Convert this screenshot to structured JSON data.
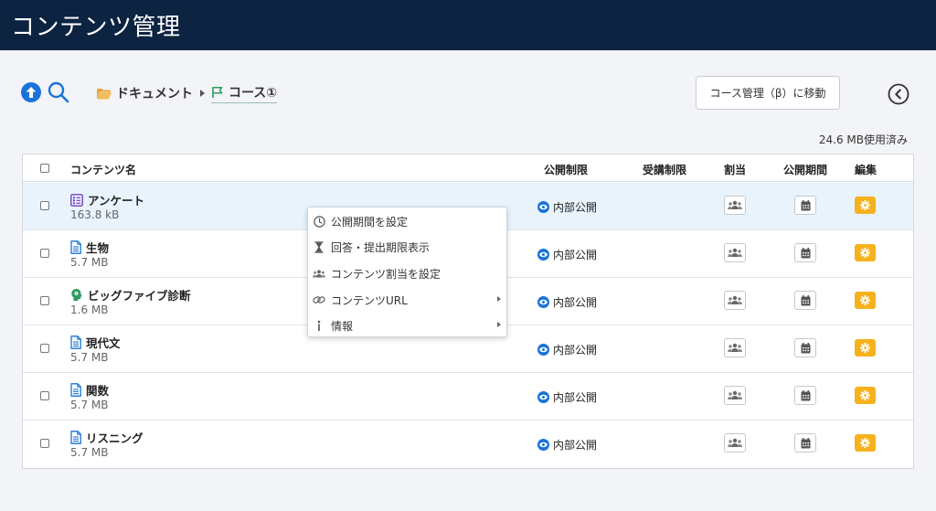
{
  "header": {
    "title": "コンテンツ管理"
  },
  "toolbar": {
    "breadcrumb": [
      {
        "label": "ドキュメント",
        "icon": "folder-icon"
      },
      {
        "label": "コース①",
        "icon": "flag-icon"
      }
    ],
    "move_button_label": "コース管理（β）に移動"
  },
  "usage": "24.6 MB使用済み",
  "table": {
    "columns": {
      "name": "コンテンツ名",
      "publish": "公開制限",
      "attend": "受講制限",
      "assign": "割当",
      "period": "公開期間",
      "edit": "編集"
    },
    "rows": [
      {
        "name": "アンケート",
        "size": "163.8 kB",
        "icon": "survey-icon",
        "publish": "内部公開"
      },
      {
        "name": "生物",
        "size": "5.7 MB",
        "icon": "document-icon",
        "publish": "内部公開"
      },
      {
        "name": "ビッグファイブ診断",
        "size": "1.6 MB",
        "icon": "head-icon",
        "publish": "内部公開"
      },
      {
        "name": "現代文",
        "size": "5.7 MB",
        "icon": "document-icon",
        "publish": "内部公開"
      },
      {
        "name": "関数",
        "size": "5.7 MB",
        "icon": "document-icon",
        "publish": "内部公開"
      },
      {
        "name": "リスニング",
        "size": "5.7 MB",
        "icon": "document-icon",
        "publish": "内部公開"
      }
    ]
  },
  "context_menu": {
    "items": [
      {
        "label": "公開期間を設定",
        "icon": "clock-icon"
      },
      {
        "label": "回答・提出期限表示",
        "icon": "hourglass-icon"
      },
      {
        "label": "コンテンツ割当を設定",
        "icon": "users-icon"
      },
      {
        "label": "コンテンツURL",
        "icon": "link-icon",
        "submenu": true
      },
      {
        "label": "情報",
        "icon": "info-icon",
        "submenu": true
      }
    ]
  },
  "colors": {
    "header_bg": "#0c2341",
    "accent_blue": "#1a73d9",
    "edit_orange": "#f5b21c",
    "selected_row": "#e8f3fc"
  }
}
